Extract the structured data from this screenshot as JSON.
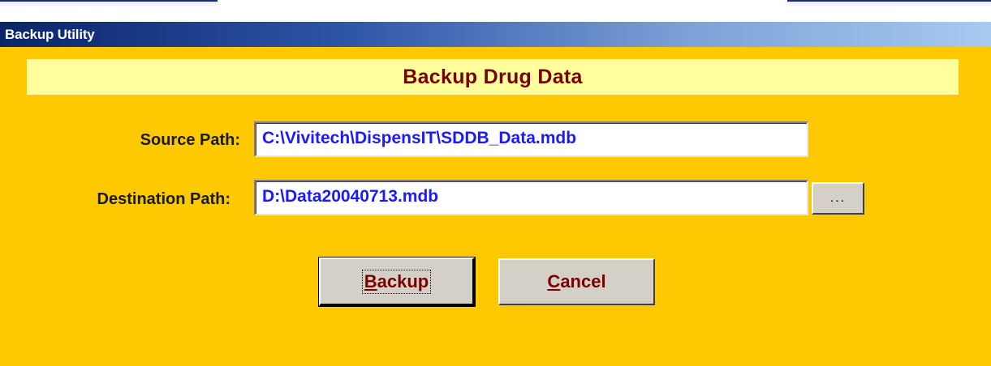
{
  "window": {
    "title": "Backup Utility"
  },
  "form": {
    "heading": "Backup Drug Data",
    "source_label": "Source Path:",
    "source_value": "C:\\Vivitech\\DispensIT\\SDDB_Data.mdb",
    "destination_label": "Destination Path:",
    "destination_value": "D:\\Data20040713.mdb",
    "browse_label": "...",
    "backup_mnemonic": "B",
    "backup_rest": "ackup",
    "cancel_mnemonic": "C",
    "cancel_rest": "ancel"
  },
  "colors": {
    "client_background": "#fec900",
    "header_band": "#ffff9c",
    "heading_text": "#7a0000",
    "field_text": "#1a1aff",
    "button_text": "#7a0000",
    "titlebar_start": "#0a246a",
    "titlebar_end": "#a6caf0"
  }
}
